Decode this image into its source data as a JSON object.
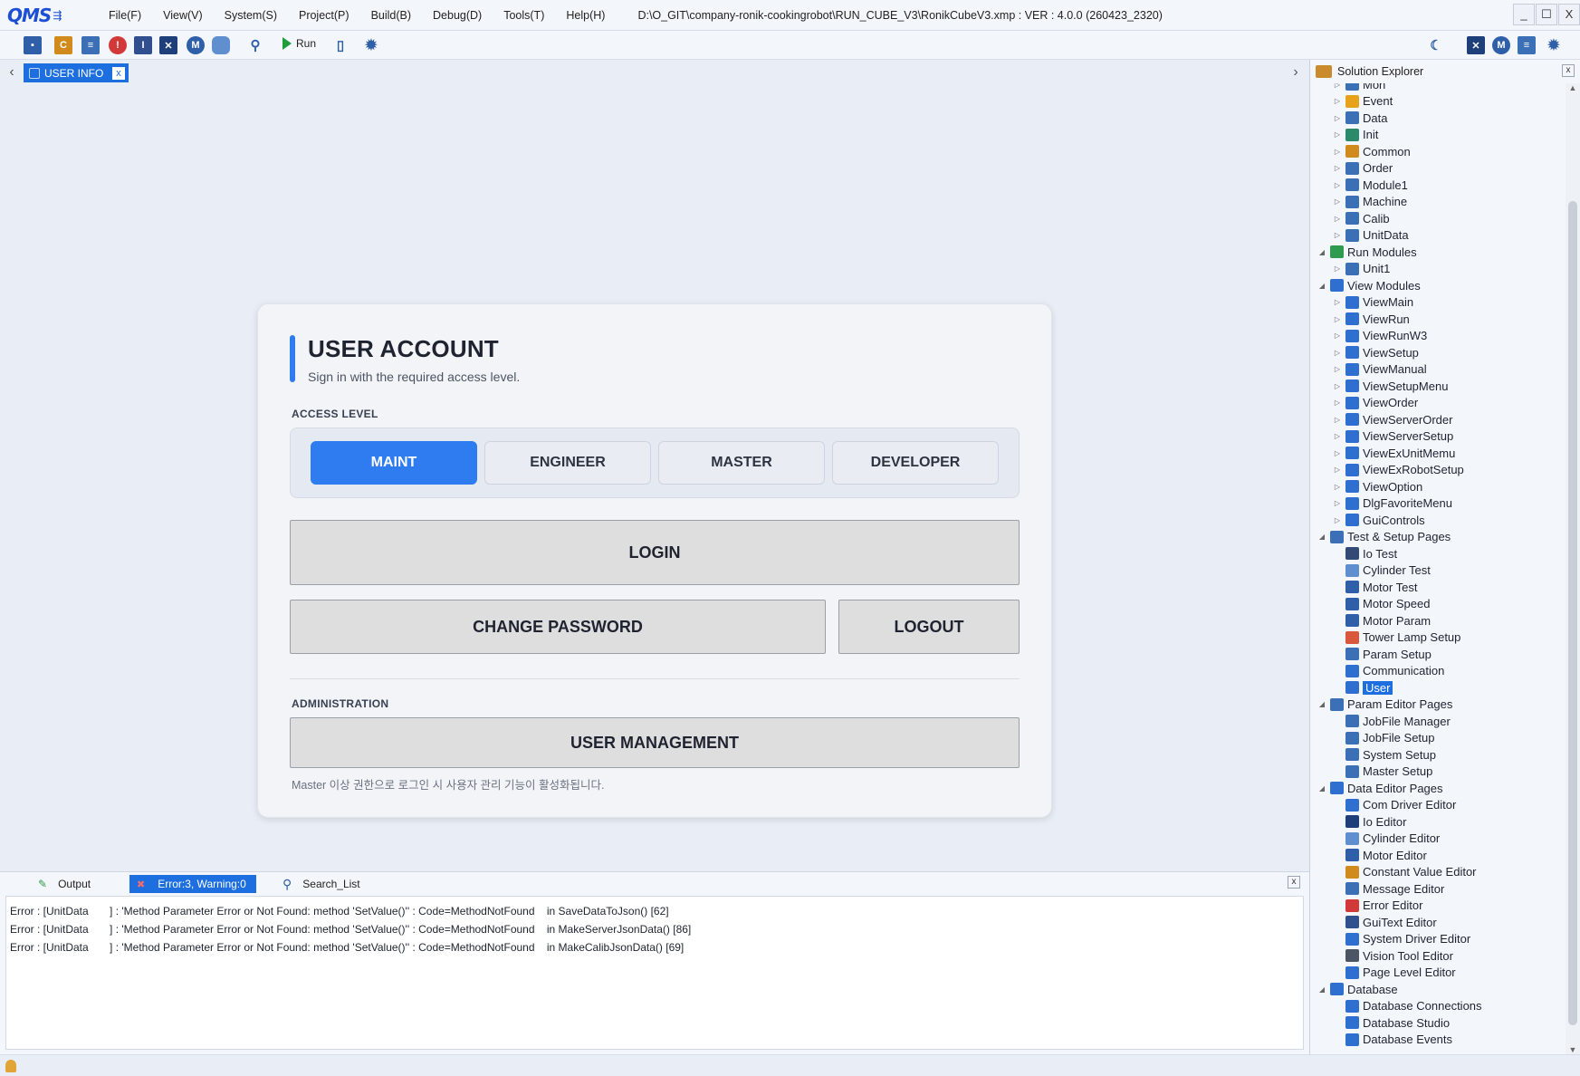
{
  "app": {
    "logo_text": "QMS",
    "menu": [
      "File(F)",
      "View(V)",
      "System(S)",
      "Project(P)",
      "Build(B)",
      "Debug(D)",
      "Tools(T)",
      "Help(H)"
    ],
    "title_path": "D:\\O_GIT\\company-ronik-cookingrobot\\RUN_CUBE_V3\\RonikCubeV3.xmp :  VER : 4.0.0 (260423_2320)",
    "window_controls": [
      "_",
      "☐",
      "X"
    ]
  },
  "toolbar": {
    "run_label": "Run",
    "accent_color": "#1d6fe0"
  },
  "document": {
    "tab_label": "USER INFO",
    "tab_close": "x"
  },
  "card": {
    "title": "USER ACCOUNT",
    "subtitle": "Sign in with the required access level.",
    "access_label": "ACCESS LEVEL",
    "levels": [
      "MAINT",
      "ENGINEER",
      "MASTER",
      "DEVELOPER"
    ],
    "active_level": "MAINT",
    "login_label": "LOGIN",
    "change_password_label": "CHANGE PASSWORD",
    "logout_label": "LOGOUT",
    "admin_label": "ADMINISTRATION",
    "user_management_label": "USER MANAGEMENT",
    "admin_note": "Master 이상 권한으로 로그인 시 사용자 관리 기능이 활성화됩니다."
  },
  "output": {
    "tabs": [
      "Output",
      "Error:3, Warning:0",
      "Search_List"
    ],
    "active_tab": "Error:3, Warning:0",
    "close": "x",
    "lines": [
      "Error : [UnitData       ] : 'Method Parameter Error or Not Found: method 'SetValue()'' : Code=MethodNotFound    in SaveDataToJson() [62]",
      "Error : [UnitData       ] : 'Method Parameter Error or Not Found: method 'SetValue()'' : Code=MethodNotFound    in MakeServerJsonData() [86]",
      "Error : [UnitData       ] : 'Method Parameter Error or Not Found: method 'SetValue()'' : Code=MethodNotFound    in MakeCalibJsonData() [69]"
    ]
  },
  "explorer": {
    "title": "Solution Explorer",
    "close": "x",
    "items": [
      {
        "label": "Mon",
        "level": 1,
        "icon": "module-icon",
        "color": "#3b6fb6"
      },
      {
        "label": "Event",
        "level": 1,
        "icon": "lightning-icon",
        "color": "#e7a21b"
      },
      {
        "label": "Data",
        "level": 1,
        "icon": "list-icon",
        "color": "#3b6fb6"
      },
      {
        "label": "Init",
        "level": 1,
        "icon": "init-icon",
        "color": "#2a8a6a"
      },
      {
        "label": "Common",
        "level": 1,
        "icon": "book-icon",
        "color": "#d18b1c"
      },
      {
        "label": "Order",
        "level": 1,
        "icon": "list-icon",
        "color": "#3b6fb6"
      },
      {
        "label": "Module1",
        "level": 1,
        "icon": "list-icon",
        "color": "#3b6fb6"
      },
      {
        "label": "Machine",
        "level": 1,
        "icon": "list-icon",
        "color": "#3b6fb6"
      },
      {
        "label": "Calib",
        "level": 1,
        "icon": "list-icon",
        "color": "#3b6fb6"
      },
      {
        "label": "UnitData",
        "level": 1,
        "icon": "list-icon",
        "color": "#3b6fb6"
      },
      {
        "label": "Run Modules",
        "level": 0,
        "icon": "run-modules-icon",
        "color": "#2e9b4f",
        "expanded": true
      },
      {
        "label": "Unit1",
        "level": 1,
        "icon": "list-icon",
        "color": "#3b6fb6"
      },
      {
        "label": "View Modules",
        "level": 0,
        "icon": "view-modules-icon",
        "color": "#2f6fcf",
        "expanded": true
      },
      {
        "label": "ViewMain",
        "level": 1,
        "icon": "view-icon",
        "color": "#2f6fcf"
      },
      {
        "label": "ViewRun",
        "level": 1,
        "icon": "view-icon",
        "color": "#2f6fcf"
      },
      {
        "label": "ViewRunW3",
        "level": 1,
        "icon": "view-icon",
        "color": "#2f6fcf"
      },
      {
        "label": "ViewSetup",
        "level": 1,
        "icon": "view-icon",
        "color": "#2f6fcf"
      },
      {
        "label": "ViewManual",
        "level": 1,
        "icon": "view-icon",
        "color": "#2f6fcf"
      },
      {
        "label": "ViewSetupMenu",
        "level": 1,
        "icon": "view-icon",
        "color": "#2f6fcf"
      },
      {
        "label": "ViewOrder",
        "level": 1,
        "icon": "view-icon",
        "color": "#2f6fcf"
      },
      {
        "label": "ViewServerOrder",
        "level": 1,
        "icon": "view-icon",
        "color": "#2f6fcf"
      },
      {
        "label": "ViewServerSetup",
        "level": 1,
        "icon": "view-icon",
        "color": "#2f6fcf"
      },
      {
        "label": "ViewExUnitMemu",
        "level": 1,
        "icon": "view-icon",
        "color": "#2f6fcf"
      },
      {
        "label": "ViewExRobotSetup",
        "level": 1,
        "icon": "view-icon",
        "color": "#2f6fcf"
      },
      {
        "label": "ViewOption",
        "level": 1,
        "icon": "view-icon",
        "color": "#2f6fcf"
      },
      {
        "label": "DlgFavoriteMenu",
        "level": 1,
        "icon": "view-icon",
        "color": "#2f6fcf"
      },
      {
        "label": "GuiControls",
        "level": 1,
        "icon": "view-icon",
        "color": "#2f6fcf"
      },
      {
        "label": "Test & Setup Pages",
        "level": 0,
        "icon": "pages-icon",
        "color": "#3b6fb6",
        "expanded": true
      },
      {
        "label": "Io Test",
        "level": 1,
        "icon": "io-icon",
        "color": "#334a77",
        "leaf": true
      },
      {
        "label": "Cylinder Test",
        "level": 1,
        "icon": "cylinder-icon",
        "color": "#5f8fcf",
        "leaf": true
      },
      {
        "label": "Motor Test",
        "level": 1,
        "icon": "motor-icon",
        "color": "#2f5fa8",
        "leaf": true
      },
      {
        "label": "Motor Speed",
        "level": 1,
        "icon": "speed-icon",
        "color": "#2f5fa8",
        "leaf": true
      },
      {
        "label": "Motor Param",
        "level": 1,
        "icon": "param-icon",
        "color": "#2f5fa8",
        "leaf": true
      },
      {
        "label": "Tower Lamp Setup",
        "level": 1,
        "icon": "tower-lamp-icon",
        "color": "#d9573b",
        "leaf": true
      },
      {
        "label": "Param Setup",
        "level": 1,
        "icon": "param-setup-icon",
        "color": "#3b6fb6",
        "leaf": true
      },
      {
        "label": "Communication",
        "level": 1,
        "icon": "communication-icon",
        "color": "#2f6fcf",
        "leaf": true
      },
      {
        "label": "User",
        "level": 1,
        "icon": "user-icon",
        "color": "#2f6fcf",
        "leaf": true,
        "selected": true
      },
      {
        "label": "Param Editor Pages",
        "level": 0,
        "icon": "pages-icon",
        "color": "#3b6fb6",
        "expanded": true
      },
      {
        "label": "JobFile Manager",
        "level": 1,
        "icon": "document-icon",
        "color": "#3b6fb6",
        "leaf": true
      },
      {
        "label": "JobFile Setup",
        "level": 1,
        "icon": "document-icon",
        "color": "#3b6fb6",
        "leaf": true
      },
      {
        "label": "System Setup",
        "level": 1,
        "icon": "document-icon",
        "color": "#3b6fb6",
        "leaf": true
      },
      {
        "label": "Master Setup",
        "level": 1,
        "icon": "document-icon",
        "color": "#3b6fb6",
        "leaf": true
      },
      {
        "label": "Data Editor Pages",
        "level": 0,
        "icon": "data-editor-icon",
        "color": "#2f6fcf",
        "expanded": true
      },
      {
        "label": "Com Driver Editor",
        "level": 1,
        "icon": "communication-icon",
        "color": "#2f6fcf",
        "leaf": true
      },
      {
        "label": "Io Editor",
        "level": 1,
        "icon": "io-editor-icon",
        "color": "#1f3f7a",
        "leaf": true
      },
      {
        "label": "Cylinder Editor",
        "level": 1,
        "icon": "cylinder-icon",
        "color": "#5f8fcf",
        "leaf": true
      },
      {
        "label": "Motor Editor",
        "level": 1,
        "icon": "motor-icon",
        "color": "#2f5fa8",
        "leaf": true
      },
      {
        "label": "Constant Value Editor",
        "level": 1,
        "icon": "constant-icon",
        "color": "#d18b1c",
        "leaf": true
      },
      {
        "label": "Message Editor",
        "level": 1,
        "icon": "message-icon",
        "color": "#3b6fb6",
        "leaf": true
      },
      {
        "label": "Error Editor",
        "level": 1,
        "icon": "error-icon",
        "color": "#d23a3a",
        "leaf": true
      },
      {
        "label": "GuiText Editor",
        "level": 1,
        "icon": "text-icon",
        "color": "#2f4f8f",
        "leaf": true
      },
      {
        "label": "System Driver Editor",
        "level": 1,
        "icon": "gear-icon",
        "color": "#2f6fcf",
        "leaf": true
      },
      {
        "label": "Vision Tool Editor",
        "level": 1,
        "icon": "camera-icon",
        "color": "#4b5563",
        "leaf": true
      },
      {
        "label": "Page Level Editor",
        "level": 1,
        "icon": "user-icon",
        "color": "#2f6fcf",
        "leaf": true
      },
      {
        "label": "Database",
        "level": 0,
        "icon": "database-group-icon",
        "color": "#2f6fcf",
        "expanded": true
      },
      {
        "label": "Database Connections",
        "level": 1,
        "icon": "cube-icon",
        "color": "#2f6fcf",
        "leaf": true
      },
      {
        "label": "Database Studio",
        "level": 1,
        "icon": "cube-icon",
        "color": "#2f6fcf",
        "leaf": true
      },
      {
        "label": "Database Events",
        "level": 1,
        "icon": "cube-icon",
        "color": "#2f6fcf",
        "leaf": true
      }
    ]
  }
}
